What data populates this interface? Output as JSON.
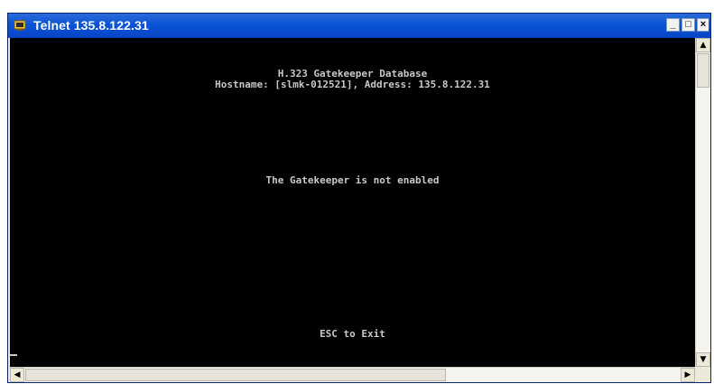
{
  "window": {
    "title": "Telnet 135.8.122.31",
    "controls": {
      "minimize": "_",
      "maximize": "□",
      "close": "×"
    }
  },
  "terminal": {
    "header_line1": "H.323 Gatekeeper Database",
    "header_line2": "Hostname: [slmk-012521], Address: 135.8.122.31",
    "message": "The Gatekeeper is not enabled",
    "footer": "ESC to Exit"
  },
  "scrollbars": {
    "up_arrow": "▲",
    "down_arrow": "▼",
    "left_arrow": "◀",
    "right_arrow": "▶"
  },
  "colors": {
    "terminal_bg": "#000000",
    "terminal_text": "#c8c8c8",
    "titlebar": "#0a53d6"
  },
  "icons": {
    "app": "telnet-app-icon"
  }
}
